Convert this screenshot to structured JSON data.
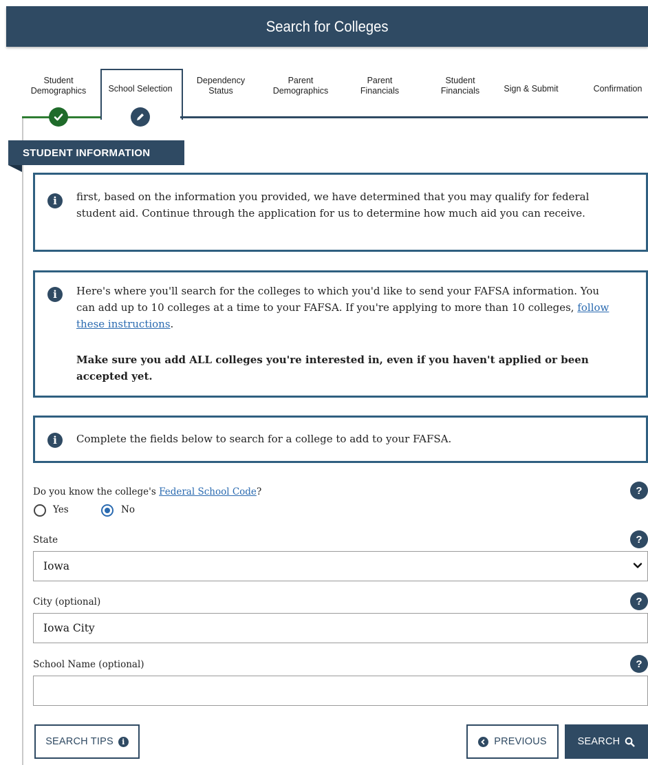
{
  "header": {
    "title": "Search for Colleges"
  },
  "steps": [
    {
      "line1": "Student",
      "line2": "Demographics",
      "state": "done"
    },
    {
      "line1": "School Selection",
      "line2": "",
      "state": "current"
    },
    {
      "line1": "Dependency",
      "line2": "Status",
      "state": "upcoming"
    },
    {
      "line1": "Parent",
      "line2": "Demographics",
      "state": "upcoming"
    },
    {
      "line1": "Parent",
      "line2": "Financials",
      "state": "upcoming"
    },
    {
      "line1": "Student",
      "line2": "Financials",
      "state": "upcoming"
    },
    {
      "line1": "Sign & Submit",
      "line2": "",
      "state": "upcoming"
    },
    {
      "line1": "Confirmation",
      "line2": "",
      "state": "upcoming"
    }
  ],
  "section": {
    "title": "STUDENT INFORMATION"
  },
  "info": {
    "box1": "first, based on the information you provided, we have determined that you may qualify for federal student aid. Continue through the application for us to determine how much aid you can receive.",
    "box2_text": "Here's where you'll search for the colleges to which you'd like to send your FAFSA information. You can add up to 10 colleges at a time to your FAFSA. If you're applying to more than 10 colleges, ",
    "box2_link": "follow these instructions",
    "box2_end": ".",
    "box2_bold": "Make sure you add ALL colleges you're interested in, even if you haven't applied or been accepted yet.",
    "box3": "Complete the fields below to search for a college to add to your FAFSA."
  },
  "form": {
    "code_question_prefix": "Do you know the college's ",
    "code_question_link": "Federal School Code",
    "code_question_suffix": "?",
    "yes_label": "Yes",
    "no_label": "No",
    "selected": "No",
    "state_label": "State",
    "state_value": "Iowa",
    "city_label": "City (optional)",
    "city_value": "Iowa City",
    "school_label": "School Name (optional)",
    "school_value": "",
    "help_glyph": "?"
  },
  "buttons": {
    "search_tips": "SEARCH TIPS",
    "previous": "PREVIOUS",
    "search": "SEARCH"
  },
  "colors": {
    "primary": "#2f4a63",
    "success": "#1f6b2a",
    "link": "#2a6ab0"
  }
}
